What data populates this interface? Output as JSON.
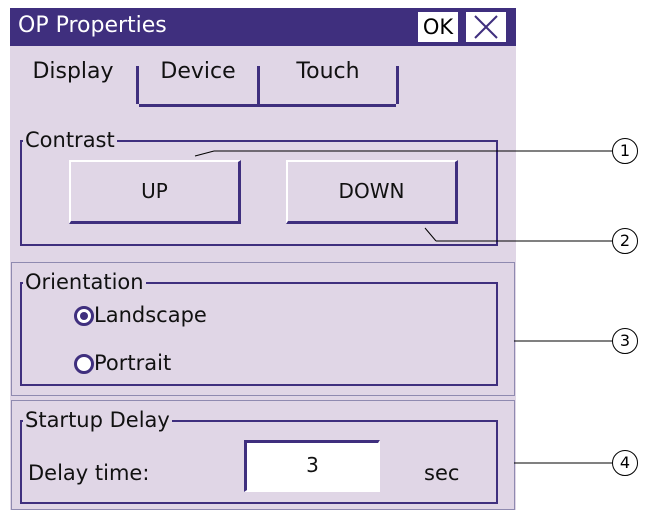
{
  "window": {
    "title": "OP Properties",
    "ok_label": "OK"
  },
  "tabs": [
    {
      "label": "Display",
      "active": true
    },
    {
      "label": "Device",
      "active": false
    },
    {
      "label": "Touch",
      "active": false
    }
  ],
  "contrast": {
    "label": "Contrast",
    "up_label": "UP",
    "down_label": "DOWN"
  },
  "orientation": {
    "label": "Orientation",
    "options": [
      {
        "label": "Landscape",
        "selected": true
      },
      {
        "label": "Portrait",
        "selected": false
      }
    ]
  },
  "startup": {
    "label": "Startup Delay",
    "delay_label": "Delay time:",
    "delay_value": "3",
    "unit": "sec"
  },
  "callouts": [
    "1",
    "2",
    "3",
    "4"
  ],
  "colors": {
    "titlebar": "#3f2f7e",
    "panel": "#e0d6e6",
    "accent": "#3f2f7e"
  },
  "icons": {
    "close": "close-icon",
    "radio_selected": "radio-selected-icon",
    "radio_unselected": "radio-unselected-icon"
  }
}
